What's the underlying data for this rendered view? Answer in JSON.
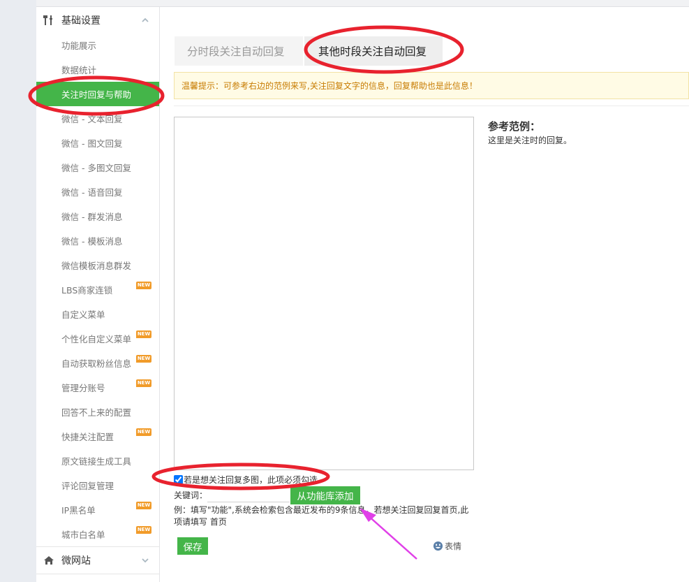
{
  "sidebar": {
    "section_top": {
      "label": "基础设置",
      "icon": "tools-icon"
    },
    "items": [
      {
        "label": "功能展示",
        "new": false,
        "active": false
      },
      {
        "label": "数据统计",
        "new": false,
        "active": false
      },
      {
        "label": "关注时回复与帮助",
        "new": false,
        "active": true
      },
      {
        "label": "微信 - 文本回复",
        "new": false,
        "active": false
      },
      {
        "label": "微信 - 图文回复",
        "new": false,
        "active": false
      },
      {
        "label": "微信 - 多图文回复",
        "new": false,
        "active": false
      },
      {
        "label": "微信 - 语音回复",
        "new": false,
        "active": false
      },
      {
        "label": "微信 - 群发消息",
        "new": false,
        "active": false
      },
      {
        "label": "微信 - 模板消息",
        "new": false,
        "active": false
      },
      {
        "label": "微信模板消息群发",
        "new": false,
        "active": false
      },
      {
        "label": "LBS商家连锁",
        "new": true,
        "active": false
      },
      {
        "label": "自定义菜单",
        "new": false,
        "active": false
      },
      {
        "label": "个性化自定义菜单",
        "new": true,
        "active": false
      },
      {
        "label": "自动获取粉丝信息",
        "new": true,
        "active": false
      },
      {
        "label": "管理分账号",
        "new": true,
        "active": false
      },
      {
        "label": "回答不上来的配置",
        "new": false,
        "active": false
      },
      {
        "label": "快捷关注配置",
        "new": true,
        "active": false
      },
      {
        "label": "原文链接生成工具",
        "new": false,
        "active": false
      },
      {
        "label": "评论回复管理",
        "new": false,
        "active": false
      },
      {
        "label": "IP黑名单",
        "new": true,
        "active": false
      },
      {
        "label": "城市白名单",
        "new": true,
        "active": false
      }
    ],
    "new_badge": "NEW",
    "section_bottom": {
      "label": "微网站",
      "icon": "home-icon"
    }
  },
  "tabs": [
    {
      "label": "分时段关注自动回复",
      "active": false
    },
    {
      "label": "其他时段关注自动回复",
      "active": true
    }
  ],
  "tip": "温馨提示：可参考右边的范例来写,关注回复文字的信息，回复帮助也是此信息！",
  "reference": {
    "title": "参考范例：",
    "text": "这里是关注时的回复。"
  },
  "form": {
    "checkbox_label": "若是想关注回复多图，此项必须勾选",
    "checkbox_checked": true,
    "keyword_label": "关键词：",
    "keyword_value": "",
    "library_button": "从功能库添加",
    "example_text": "例：填写\"功能\",系统会检索包含最近发布的9条信息，若想关注回复回复首页,此项请填写 首页",
    "save_button": "保存",
    "emoji_label": "表情"
  },
  "colors": {
    "accent_green": "#44b549",
    "annotation_red": "#e8222e",
    "annotation_arrow": "#e040e8",
    "tip_text": "#c77b00",
    "new_badge": "#f19b29"
  }
}
